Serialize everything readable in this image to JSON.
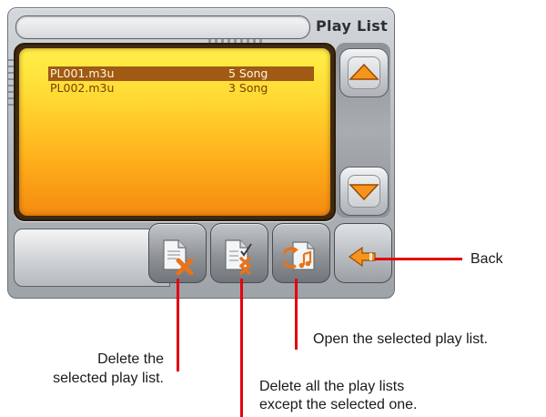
{
  "screen": {
    "title": "Play List"
  },
  "playlist": {
    "rows": [
      {
        "name": "PL001.m3u",
        "count": "5 Song",
        "selected": true
      },
      {
        "name": "PL002.m3u",
        "count": "3 Song",
        "selected": false
      }
    ]
  },
  "toolbar": {
    "buttons": [
      {
        "id": "delete",
        "icon": "document-delete-icon"
      },
      {
        "id": "delete-others",
        "icon": "document-checklist-delete-icon"
      },
      {
        "id": "open",
        "icon": "document-open-music-icon"
      },
      {
        "id": "back",
        "icon": "back-arrow-icon"
      }
    ]
  },
  "callouts": {
    "back": "Back",
    "open": "Open the selected play list.",
    "delete_line1": "Delete the",
    "delete_line2": "selected play list.",
    "delete_others_line1": "Delete all the play lists",
    "delete_others_line2": "except the selected one."
  },
  "colors": {
    "selection": "#a05a14",
    "leader": "#e3000f",
    "accent_orange": "#f58a10"
  }
}
